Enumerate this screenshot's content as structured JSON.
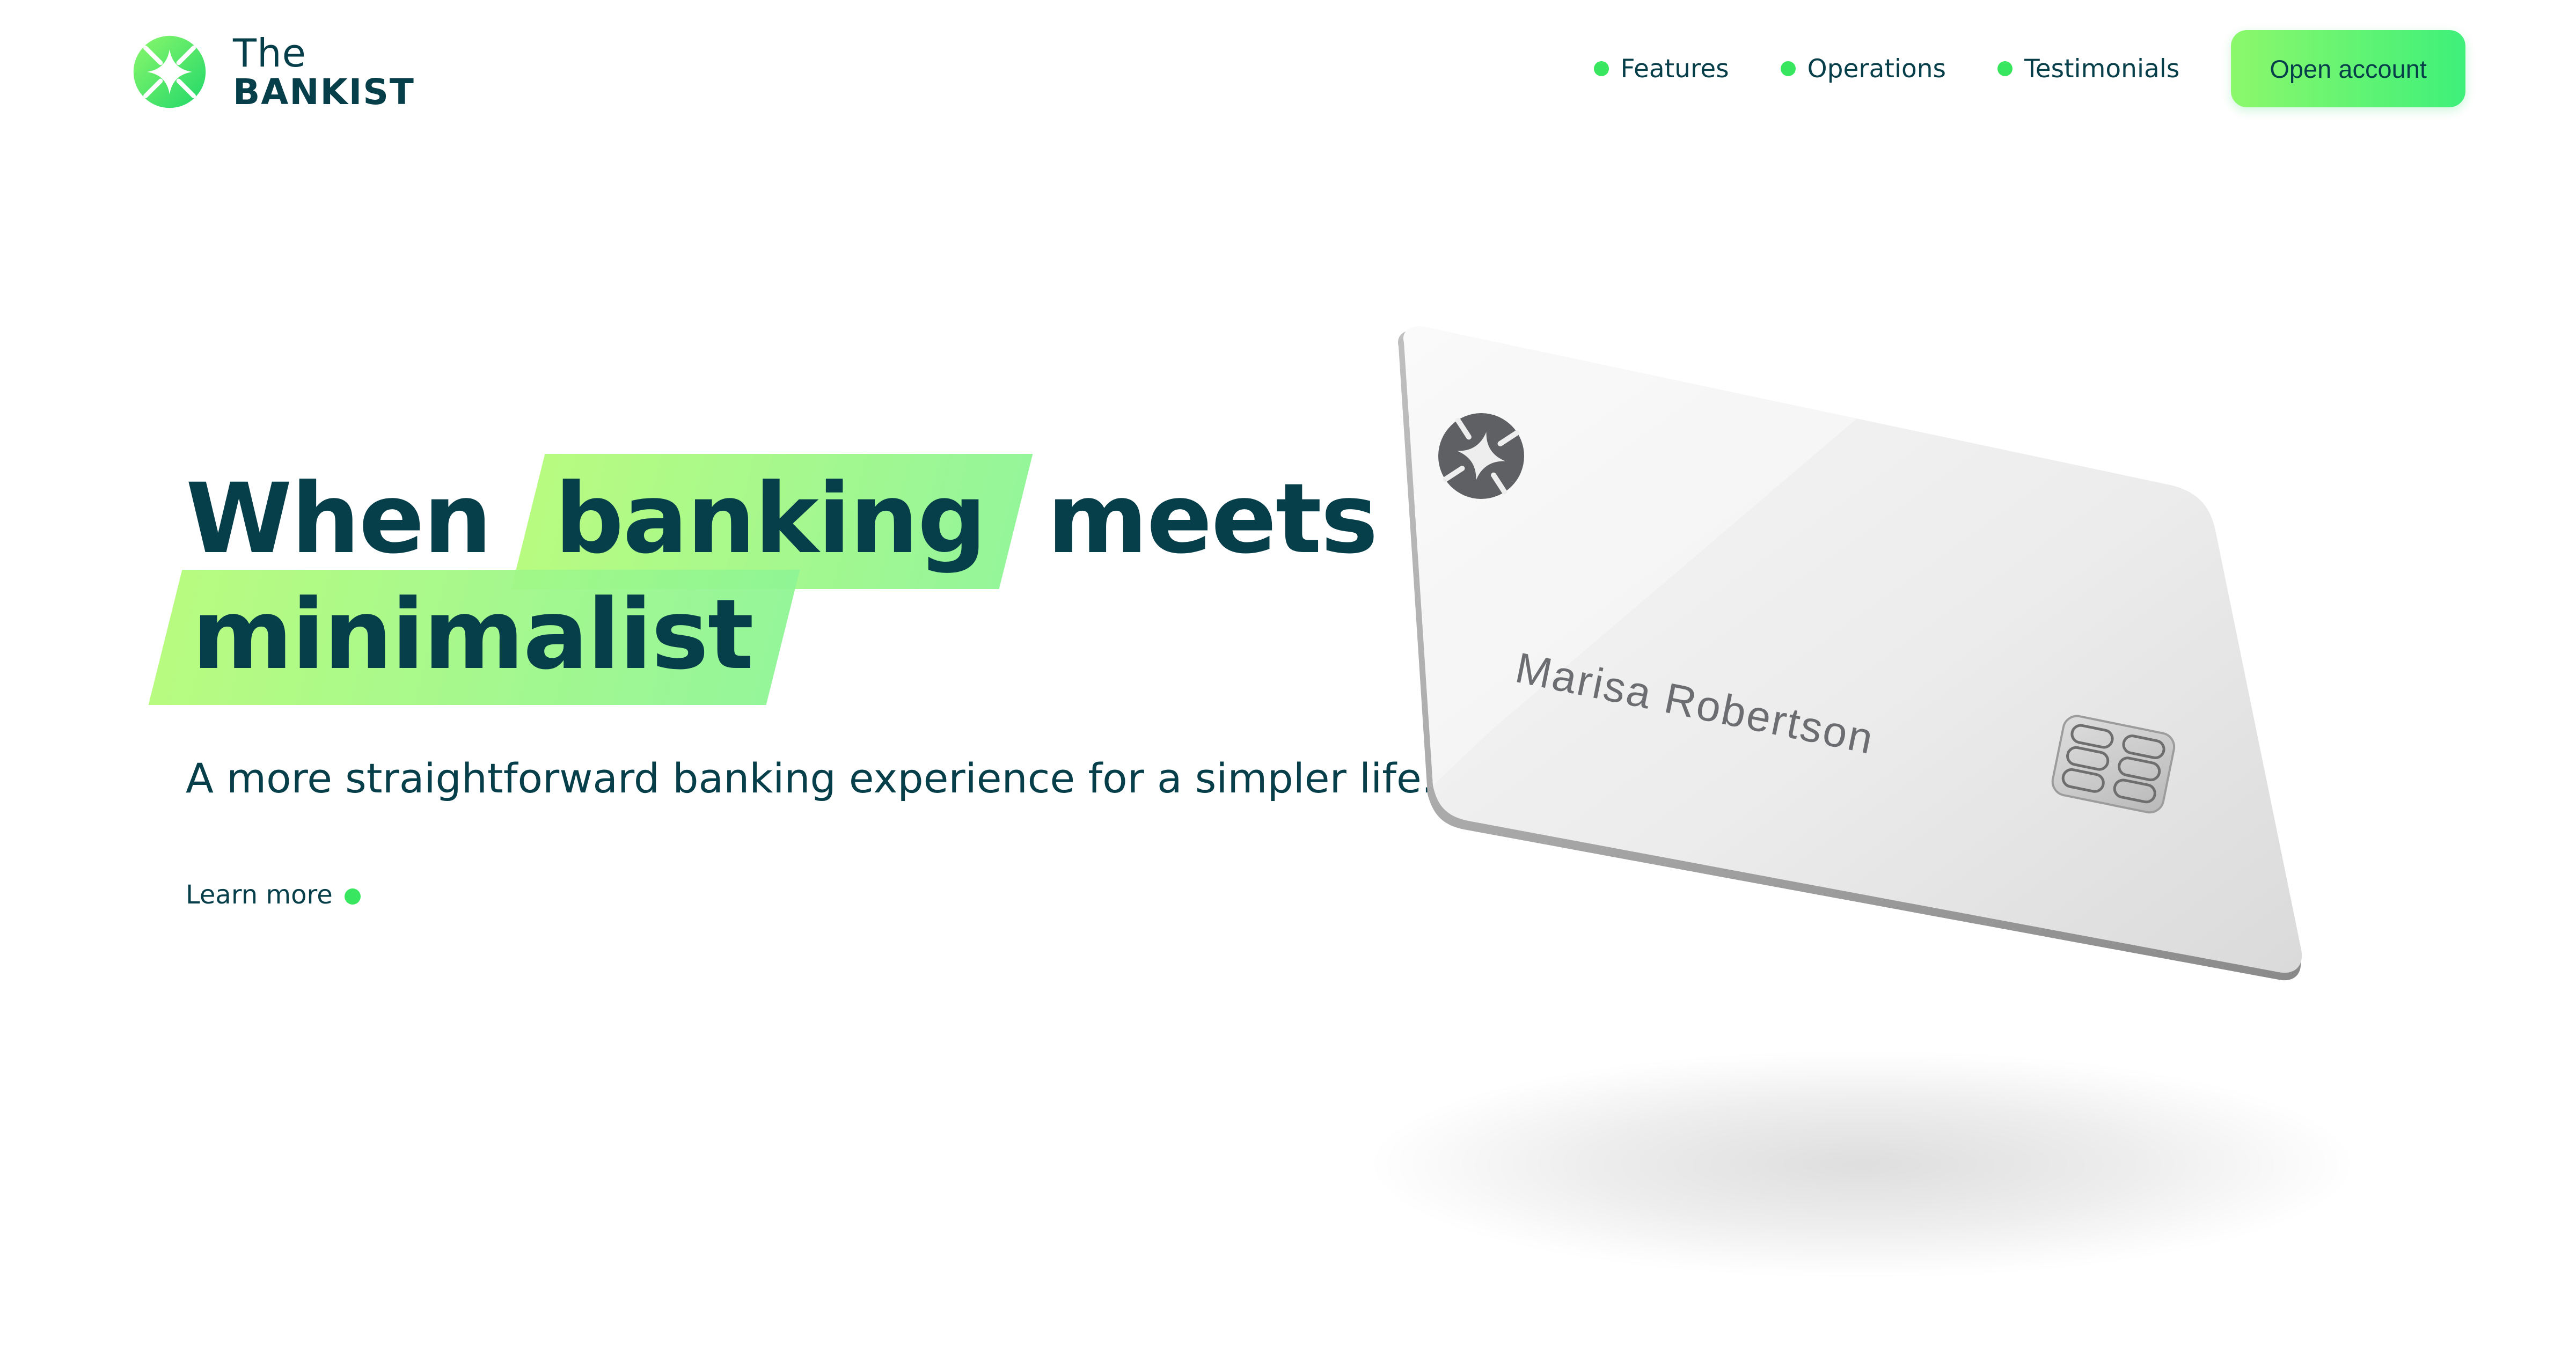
{
  "brand": {
    "line1": "The",
    "line2": "BANKIST",
    "accent_color": "#39e65f",
    "text_color": "#063f4a"
  },
  "nav": {
    "items": [
      {
        "label": "Features"
      },
      {
        "label": "Operations"
      },
      {
        "label": "Testimonials"
      }
    ],
    "cta_label": "Open account"
  },
  "hero": {
    "title_word1": "When",
    "title_highlight1": "banking",
    "title_word2": "meets",
    "title_highlight2": "minimalist",
    "subtitle": "A more straightforward banking experience for a simpler life.",
    "learn_more": "Learn more"
  },
  "card": {
    "holder_name": "Marisa Robertson"
  }
}
